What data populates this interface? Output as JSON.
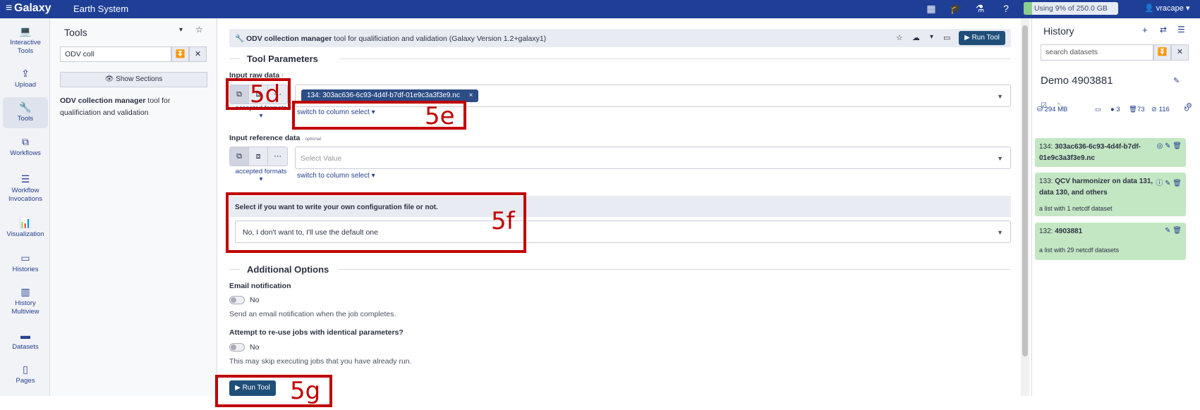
{
  "topbar": {
    "brand": "Galaxy",
    "app_name": "Earth System",
    "quota_text": "Using 9% of 250.0 GB",
    "quota_fraction": 0.09,
    "user": "vracape",
    "icons": [
      "grid-icon",
      "graduation-cap-icon",
      "flask-icon",
      "help-icon"
    ]
  },
  "leftnav": [
    {
      "label": "Interactive Tools",
      "icon": "laptop-icon"
    },
    {
      "label": "Upload",
      "icon": "upload-icon"
    },
    {
      "label": "Tools",
      "icon": "wrench-icon"
    },
    {
      "label": "Workflows",
      "icon": "sitemap-icon"
    },
    {
      "label": "Workflow Invocations",
      "icon": "list-icon"
    },
    {
      "label": "Visualization",
      "icon": "chart-icon"
    },
    {
      "label": "Histories",
      "icon": "hdd-icon"
    },
    {
      "label": "History Multiview",
      "icon": "columns-icon"
    },
    {
      "label": "Datasets",
      "icon": "folder-icon"
    },
    {
      "label": "Pages",
      "icon": "file-icon"
    }
  ],
  "toolpanel": {
    "title": "Tools",
    "search_value": "ODV coll",
    "show_sections": "Show Sections",
    "tool_name": "ODV collection manager",
    "tool_desc": "tool for qualificiation and validation"
  },
  "form": {
    "header_name": "ODV collection manager",
    "header_desc": "tool for qualificiation and validation (Galaxy Version 1.2+galaxy1)",
    "run_tool": "Run Tool",
    "section_params": "Tool Parameters",
    "input_raw_label": "Input raw data",
    "required_mark": "*",
    "input_raw_value": "134: 303ac636-6c93-4d4f-b7df-01e9c3a3f3e9.nc",
    "accepted_formats": "accepted formats",
    "switch_column": "switch to column select",
    "input_ref_label": "Input reference data",
    "optional": "- optional",
    "select_placeholder": "Select Value",
    "cond_label": "Select if you want to write your own configuration file or not.",
    "cond_value": "No, I don't want to, I'll use the default one",
    "section_additional": "Additional Options",
    "email_label": "Email notification",
    "email_value": "No",
    "email_help": "Send an email notification when the job completes.",
    "reuse_label": "Attempt to re-use jobs with identical parameters?",
    "reuse_value": "No",
    "reuse_help": "This may skip executing jobs that you have already run."
  },
  "annotations": [
    "5d",
    "5e",
    "5f",
    "5g"
  ],
  "history": {
    "title": "History",
    "search_placeholder": "search datasets",
    "name": "Demo 4903881",
    "size": "294 MB",
    "count_shown": "3",
    "count_deleted": "73",
    "count_hidden": "116",
    "items": [
      {
        "hid": "134:",
        "name": "303ac636-6c93-4d4f-b7df-01e9c3a3f3e9.nc",
        "sub": ""
      },
      {
        "hid": "133:",
        "name": "QCV harmonizer on data 131, data 130, and others",
        "sub": "a list with 1 netcdf dataset"
      },
      {
        "hid": "132:",
        "name": "4903881",
        "sub": "a list with 29 netcdf datasets"
      }
    ]
  }
}
